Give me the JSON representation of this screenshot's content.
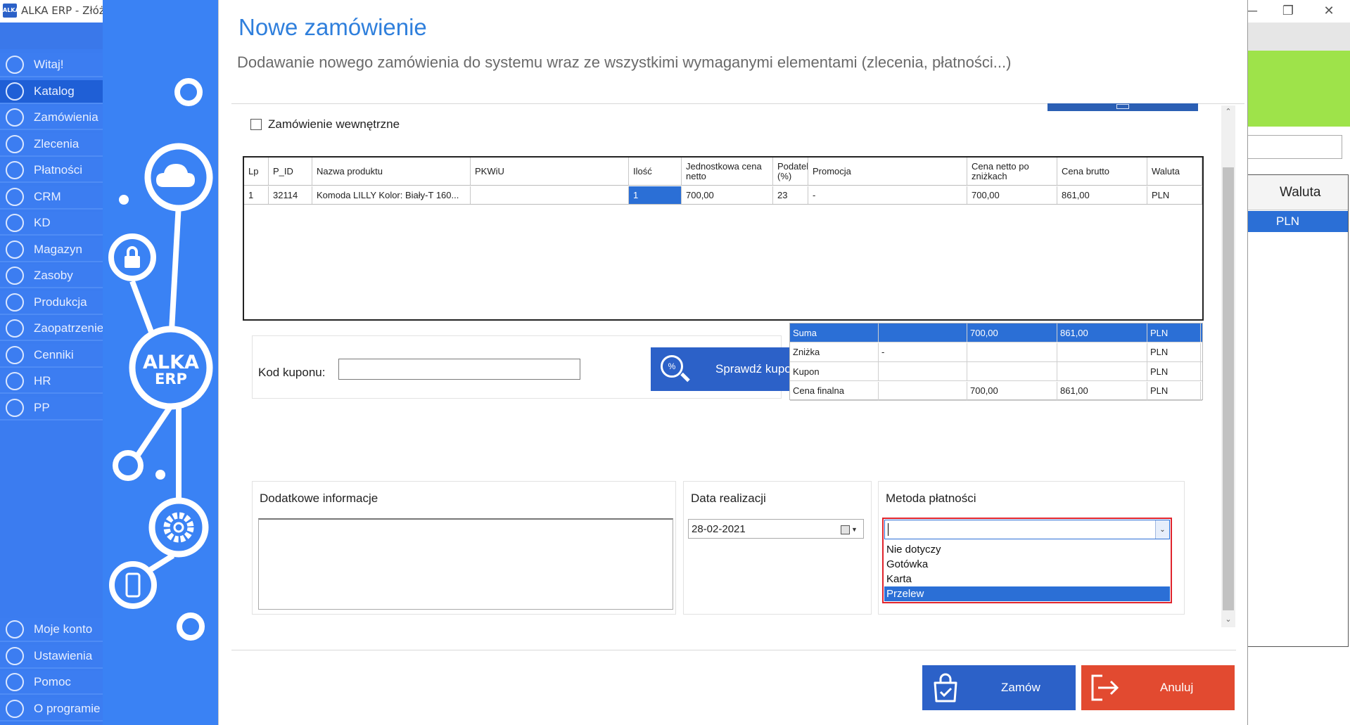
{
  "window": {
    "title": "ALKA ERP - Złóż z",
    "app_icon_text": "ALKA"
  },
  "nav": {
    "top_items": [
      {
        "label": "Witaj!",
        "icon": "home-icon"
      },
      {
        "label": "Katalog",
        "icon": "book-icon"
      },
      {
        "label": "Zamówienia",
        "icon": "cart-icon"
      },
      {
        "label": "Zlecenia",
        "icon": "list-icon"
      },
      {
        "label": "Płatności",
        "icon": "dollar-icon"
      },
      {
        "label": "CRM",
        "icon": "crm-icon"
      },
      {
        "label": "KD",
        "icon": "person-icon"
      },
      {
        "label": "Magazyn",
        "icon": "warehouse-icon"
      },
      {
        "label": "Zasoby",
        "icon": "resources-icon"
      },
      {
        "label": "Produkcja",
        "icon": "production-icon"
      },
      {
        "label": "Zaopatrzenie",
        "icon": "truck-icon"
      },
      {
        "label": "Cenniki",
        "icon": "tag-icon"
      },
      {
        "label": "HR",
        "icon": "hr-icon"
      },
      {
        "label": "PP",
        "icon": "pp-icon"
      }
    ],
    "bottom_items": [
      {
        "label": "Moje konto",
        "icon": "account-icon"
      },
      {
        "label": "Ustawienia",
        "icon": "settings-icon"
      },
      {
        "label": "Pomoc",
        "icon": "help-icon"
      },
      {
        "label": "O programie",
        "icon": "info-icon"
      }
    ],
    "active_label": "Katalog"
  },
  "deco": {
    "logo_line1": "ALKA",
    "logo_line2": "ERP"
  },
  "dialog": {
    "title": "Nowe zamówienie",
    "subtitle": "Dodawanie nowego zamówienia do systemu wraz ze wszystkimi wymaganymi elementami (zlecenia, płatności...)",
    "internal_order_label": "Zamówienie wewnętrzne",
    "grid": {
      "headers": [
        "Lp",
        "P_ID",
        "Nazwa produktu",
        "PKWiU",
        "Ilość",
        "Jednostkowa cena netto",
        "Podatek (%)",
        "Promocja",
        "Cena netto po zniżkach",
        "Cena brutto",
        "Waluta"
      ],
      "rows": [
        [
          "1",
          "32114",
          "Komoda LILLY Kolor: Biały-T 160...",
          "",
          "1",
          "700,00",
          "23",
          "-",
          "700,00",
          "861,00",
          "PLN"
        ]
      ]
    },
    "coupon": {
      "label": "Kod kuponu:",
      "value": "",
      "button_label": "Sprawdź kupon",
      "button_icon_text": "%"
    },
    "summary": [
      [
        "Suma",
        "",
        "700,00",
        "861,00",
        "PLN"
      ],
      [
        "Zniżka",
        "-",
        "",
        "",
        "PLN"
      ],
      [
        "Kupon",
        "",
        "",
        "",
        "PLN"
      ],
      [
        "Cena finalna",
        "",
        "700,00",
        "861,00",
        "PLN"
      ]
    ],
    "additional_info": {
      "title": "Dodatkowe informacje",
      "value": ""
    },
    "realization_date": {
      "title": "Data realizacji",
      "value": "28-02-2021"
    },
    "payment_method": {
      "title": "Metoda płatności",
      "value": "",
      "options": [
        "Nie dotyczy",
        "Gotówka",
        "Karta",
        "Przelew"
      ],
      "highlighted": "Przelew"
    },
    "buttons": {
      "order": "Zamów",
      "cancel": "Anuluj"
    }
  },
  "background_right": {
    "column_header": "Waluta",
    "row_value": "PLN"
  },
  "colors": {
    "nav_bg": "#3b7cf0",
    "accent": "#2c61c8",
    "selection": "#2b6fd6",
    "cancel": "#e24a30",
    "highlight_border": "#e0242d",
    "green_banner": "#9ee34a"
  }
}
